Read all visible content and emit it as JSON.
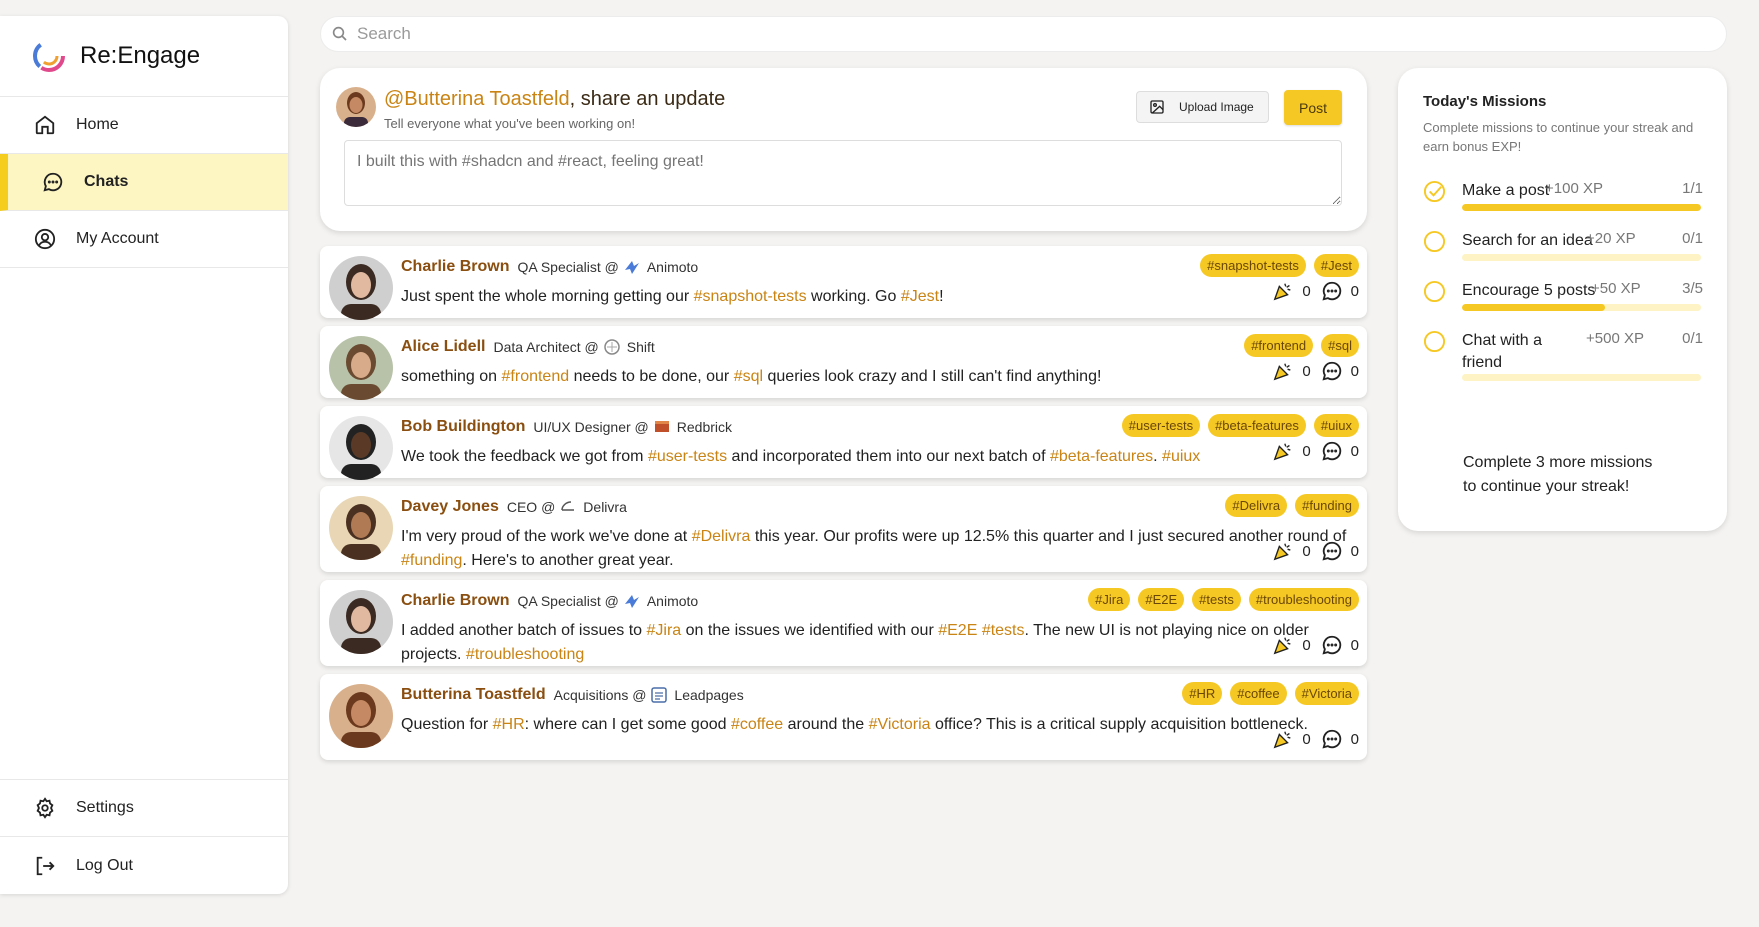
{
  "brand": {
    "name": "Re:Engage"
  },
  "nav": {
    "items": [
      {
        "label": "Home",
        "icon": "home-icon"
      },
      {
        "label": "Chats",
        "icon": "chat-icon"
      },
      {
        "label": "My Account",
        "icon": "account-icon"
      }
    ],
    "bottom": [
      {
        "label": "Settings",
        "icon": "gear-icon"
      },
      {
        "label": "Log Out",
        "icon": "logout-icon"
      }
    ]
  },
  "search": {
    "placeholder": "Search"
  },
  "composer": {
    "handle": "@Butterina Toastfeld",
    "title_suffix": ", share an update",
    "subtitle": "Tell everyone what you've been working on!",
    "upload_label": "Upload Image",
    "post_label": "Post",
    "placeholder": "I built this with #shadcn and #react, feeling great!"
  },
  "posts": [
    {
      "author": "Charlie Brown",
      "role": "QA Specialist @",
      "company": "Animoto",
      "tags": [
        "#snapshot-tests",
        "#Jest"
      ],
      "body": [
        {
          "t": "Just spent the whole morning getting our "
        },
        {
          "t": "#snapshot-tests",
          "tag": true
        },
        {
          "t": " working. Go "
        },
        {
          "t": "#Jest",
          "tag": true
        },
        {
          "t": "!"
        }
      ],
      "likes": "0",
      "comments": "0"
    },
    {
      "author": "Alice Lidell",
      "role": "Data Architect @",
      "company": "Shift",
      "tags": [
        "#frontend",
        "#sql"
      ],
      "body": [
        {
          "t": "something on "
        },
        {
          "t": "#frontend",
          "tag": true
        },
        {
          "t": " needs to be done, our "
        },
        {
          "t": "#sql",
          "tag": true
        },
        {
          "t": " queries look crazy and I still can't find anything!"
        }
      ],
      "likes": "0",
      "comments": "0"
    },
    {
      "author": "Bob Buildington",
      "role": "UI/UX Designer @",
      "company": "Redbrick",
      "tags": [
        "#user-tests",
        "#beta-features",
        "#uiux"
      ],
      "body": [
        {
          "t": "We took the feedback we got from "
        },
        {
          "t": "#user-tests",
          "tag": true
        },
        {
          "t": " and incorporated them into our next batch of "
        },
        {
          "t": "#beta-features",
          "tag": true
        },
        {
          "t": ". "
        },
        {
          "t": "#uiux",
          "tag": true
        }
      ],
      "likes": "0",
      "comments": "0"
    },
    {
      "author": "Davey Jones",
      "role": "CEO @",
      "company": "Delivra",
      "tags": [
        "#Delivra",
        "#funding"
      ],
      "body": [
        {
          "t": "I'm very proud of the work we've done at "
        },
        {
          "t": "#Delivra",
          "tag": true
        },
        {
          "t": " this year. Our profits were up 12.5% this quarter and I just secured another round of "
        },
        {
          "t": "#funding",
          "tag": true
        },
        {
          "t": ". Here's to another great year."
        }
      ],
      "likes": "0",
      "comments": "0"
    },
    {
      "author": "Charlie Brown",
      "role": "QA Specialist @",
      "company": "Animoto",
      "tags": [
        "#Jira",
        "#E2E",
        "#tests",
        "#troubleshooting"
      ],
      "body": [
        {
          "t": "I added another batch of issues to "
        },
        {
          "t": "#Jira",
          "tag": true
        },
        {
          "t": " on the issues we identified with our "
        },
        {
          "t": "#E2E",
          "tag": true
        },
        {
          "t": " "
        },
        {
          "t": "#tests",
          "tag": true
        },
        {
          "t": ". The new UI is not playing nice on older projects. "
        },
        {
          "t": "#troubleshooting",
          "tag": true
        }
      ],
      "likes": "0",
      "comments": "0"
    },
    {
      "author": "Butterina Toastfeld",
      "role": "Acquisitions @",
      "company": "Leadpages",
      "tags": [
        "#HR",
        "#coffee",
        "#Victoria"
      ],
      "body": [
        {
          "t": "Question for "
        },
        {
          "t": "#HR",
          "tag": true
        },
        {
          "t": ": where can I get some good "
        },
        {
          "t": "#coffee",
          "tag": true
        },
        {
          "t": " around the "
        },
        {
          "t": "#Victoria",
          "tag": true
        },
        {
          "t": " office? This is a critical supply acquisition bottleneck."
        }
      ],
      "likes": "0",
      "comments": "0"
    }
  ],
  "missions": {
    "title": "Today's Missions",
    "subtitle": "Complete missions to continue your streak and earn bonus EXP!",
    "items": [
      {
        "name": "Make a post",
        "xp": "+100 XP",
        "progress": "1/1",
        "fraction": 1.0,
        "done": true
      },
      {
        "name": "Search for an idea",
        "xp": "+20 XP",
        "progress": "0/1",
        "fraction": 0.0,
        "done": false
      },
      {
        "name": "Encourage 5 posts",
        "xp": "+50 XP",
        "progress": "3/5",
        "fraction": 0.6,
        "done": false
      },
      {
        "name": "Chat with a friend",
        "xp": "+500 XP",
        "progress": "0/1",
        "fraction": 0.0,
        "done": false
      }
    ],
    "footer": "Complete 3 more missions to continue your streak!"
  },
  "colors": {
    "accent": "#f6c823",
    "author": "#8a4f10",
    "hashtag": "#c98414",
    "active_bg": "#fdf6c3"
  }
}
